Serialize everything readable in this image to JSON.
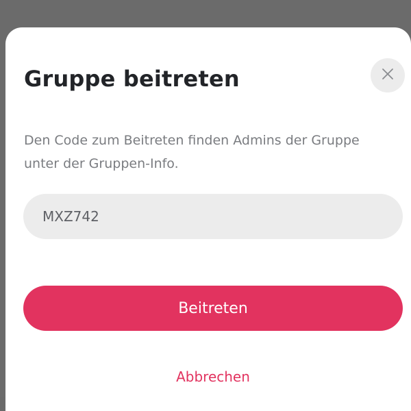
{
  "dialog": {
    "title": "Gruppe beitreten",
    "description": "Den Code zum Beitreten finden Admins der Gruppe unter der Gruppen-Info.",
    "code_input": {
      "value": "MXZ742",
      "placeholder": ""
    },
    "join_button_label": "Beitreten",
    "cancel_label": "Abbrechen",
    "close_icon": "close-icon"
  },
  "colors": {
    "accent": "#e2335f",
    "input_background": "#ececec",
    "title_text": "#222428",
    "description_text": "#7a7c80",
    "backdrop": "#6b6b6b"
  }
}
